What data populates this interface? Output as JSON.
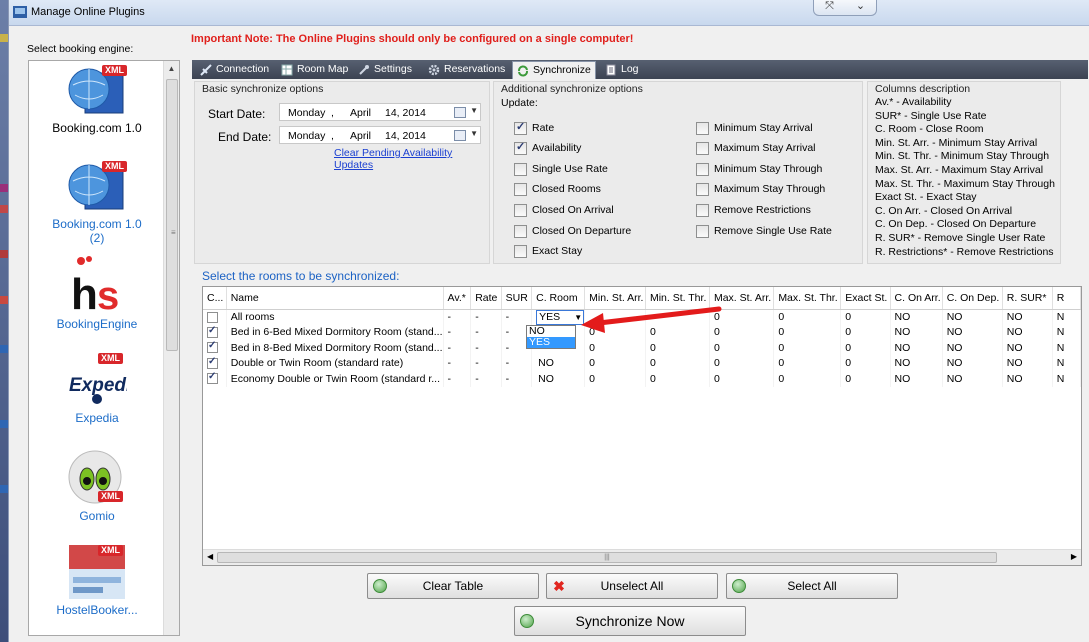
{
  "window": {
    "title": "Manage Online Plugins"
  },
  "left": {
    "label": "Select booking engine:",
    "engines": [
      {
        "name": "Booking.com 1.0",
        "badge": "XML",
        "selected": true
      },
      {
        "name": "Booking.com 1.0 (2)",
        "badge": "XML",
        "selected": false
      },
      {
        "name": "BookingEngine",
        "badge": "",
        "selected": false
      },
      {
        "name": "Expedia",
        "badge": "XML",
        "selected": false
      },
      {
        "name": "Gomio",
        "badge": "XML",
        "selected": false
      },
      {
        "name": "HostelBooker...",
        "badge": "XML",
        "selected": false
      }
    ]
  },
  "important_note": "Important Note: The Online Plugins should only be configured on a single computer!",
  "tabs": [
    {
      "label": "Connection",
      "icon": "connection-icon"
    },
    {
      "label": "Room Map",
      "icon": "room-map-icon"
    },
    {
      "label": "Settings",
      "icon": "settings-icon"
    },
    {
      "label": "Reservations",
      "icon": "gear-icon"
    },
    {
      "label": "Synchronize",
      "icon": "synchronize-icon",
      "active": true
    },
    {
      "label": "Log",
      "icon": "log-icon"
    }
  ],
  "basic": {
    "title": "Basic synchronize options",
    "start_label": "Start Date:",
    "end_label": "End Date:",
    "start": {
      "weekday": "Monday",
      "sep": ",",
      "month": "April",
      "date": "14, 2014"
    },
    "end": {
      "weekday": "Monday",
      "sep": ",",
      "month": "April",
      "date": "14, 2014"
    },
    "clear_link": "Clear Pending Availability Updates"
  },
  "additional": {
    "title": "Additional synchronize options",
    "update_label": "Update:",
    "left_options": [
      {
        "label": "Rate",
        "checked": true
      },
      {
        "label": "Availability",
        "checked": true
      },
      {
        "label": "Single Use Rate",
        "checked": false
      },
      {
        "label": "Closed Rooms",
        "checked": false
      },
      {
        "label": "Closed On Arrival",
        "checked": false
      },
      {
        "label": "Closed On Departure",
        "checked": false
      },
      {
        "label": "Exact Stay",
        "checked": false
      }
    ],
    "right_options": [
      {
        "label": "Minimum Stay Arrival",
        "checked": false
      },
      {
        "label": "Maximum Stay Arrival",
        "checked": false
      },
      {
        "label": "Minimum Stay Through",
        "checked": false
      },
      {
        "label": "Maximum Stay Through",
        "checked": false
      },
      {
        "label": "Remove Restrictions",
        "checked": false
      },
      {
        "label": "Remove Single Use Rate",
        "checked": false
      }
    ]
  },
  "columns_desc": {
    "title": "Columns description",
    "lines": [
      "Av.* - Availability",
      "SUR* - Single Use Rate",
      "C. Room - Close Room",
      "Min. St. Arr. - Minimum Stay Arrival",
      "Min. St. Thr. - Minimum Stay Through",
      "Max. St. Arr. - Maximum Stay Arrival",
      "Max. St. Thr. - Maximum Stay Through",
      "Exact St. - Exact Stay",
      "C. On Arr. - Closed On Arrival",
      "C. On Dep. - Closed On Departure",
      "R. SUR* - Remove Single User Rate",
      "R. Restrictions* - Remove Restrictions"
    ]
  },
  "rooms_label": "Select the rooms to be synchronized:",
  "grid": {
    "headers": [
      "C...",
      "Name",
      "Av.*",
      "Rate",
      "SUR",
      "C. Room",
      "Min. St. Arr.",
      "Min. St. Thr.",
      "Max. St. Arr.",
      "Max. St. Thr.",
      "Exact St.",
      "C. On Arr.",
      "C. On Dep.",
      "R. SUR*",
      "R"
    ],
    "rows": [
      {
        "checked": false,
        "cells": [
          "All rooms",
          "-",
          "-",
          "-",
          "YES",
          "",
          "",
          "0",
          "0",
          "0",
          "NO",
          "NO",
          "NO",
          "N"
        ]
      },
      {
        "checked": true,
        "cells": [
          "Bed in 6-Bed Mixed Dormitory Room (stand...",
          "-",
          "-",
          "-",
          "",
          "0",
          "0",
          "0",
          "0",
          "0",
          "NO",
          "NO",
          "NO",
          "N"
        ]
      },
      {
        "checked": true,
        "cells": [
          "Bed in 8-Bed Mixed Dormitory Room (stand...",
          "-",
          "-",
          "-",
          "",
          "0",
          "0",
          "0",
          "0",
          "0",
          "NO",
          "NO",
          "NO",
          "N"
        ]
      },
      {
        "checked": true,
        "cells": [
          "Double or Twin Room (standard rate)",
          "-",
          "-",
          "-",
          "NO",
          "0",
          "0",
          "0",
          "0",
          "0",
          "NO",
          "NO",
          "NO",
          "N"
        ]
      },
      {
        "checked": true,
        "cells": [
          "Economy Double or Twin Room (standard r...",
          "-",
          "-",
          "-",
          "NO",
          "0",
          "0",
          "0",
          "0",
          "0",
          "NO",
          "NO",
          "NO",
          "N"
        ]
      }
    ],
    "dropdown_options": [
      "NO",
      "YES"
    ],
    "dropdown_selected": "YES"
  },
  "buttons": {
    "clear": "Clear Table",
    "unselect": "Unselect All",
    "select": "Select All",
    "sync": "Synchronize Now"
  },
  "colors": {
    "important": "#e0201c",
    "link": "#1a3fd1",
    "rooms_label": "#1c62c4",
    "arrow": "#e31b1b"
  }
}
